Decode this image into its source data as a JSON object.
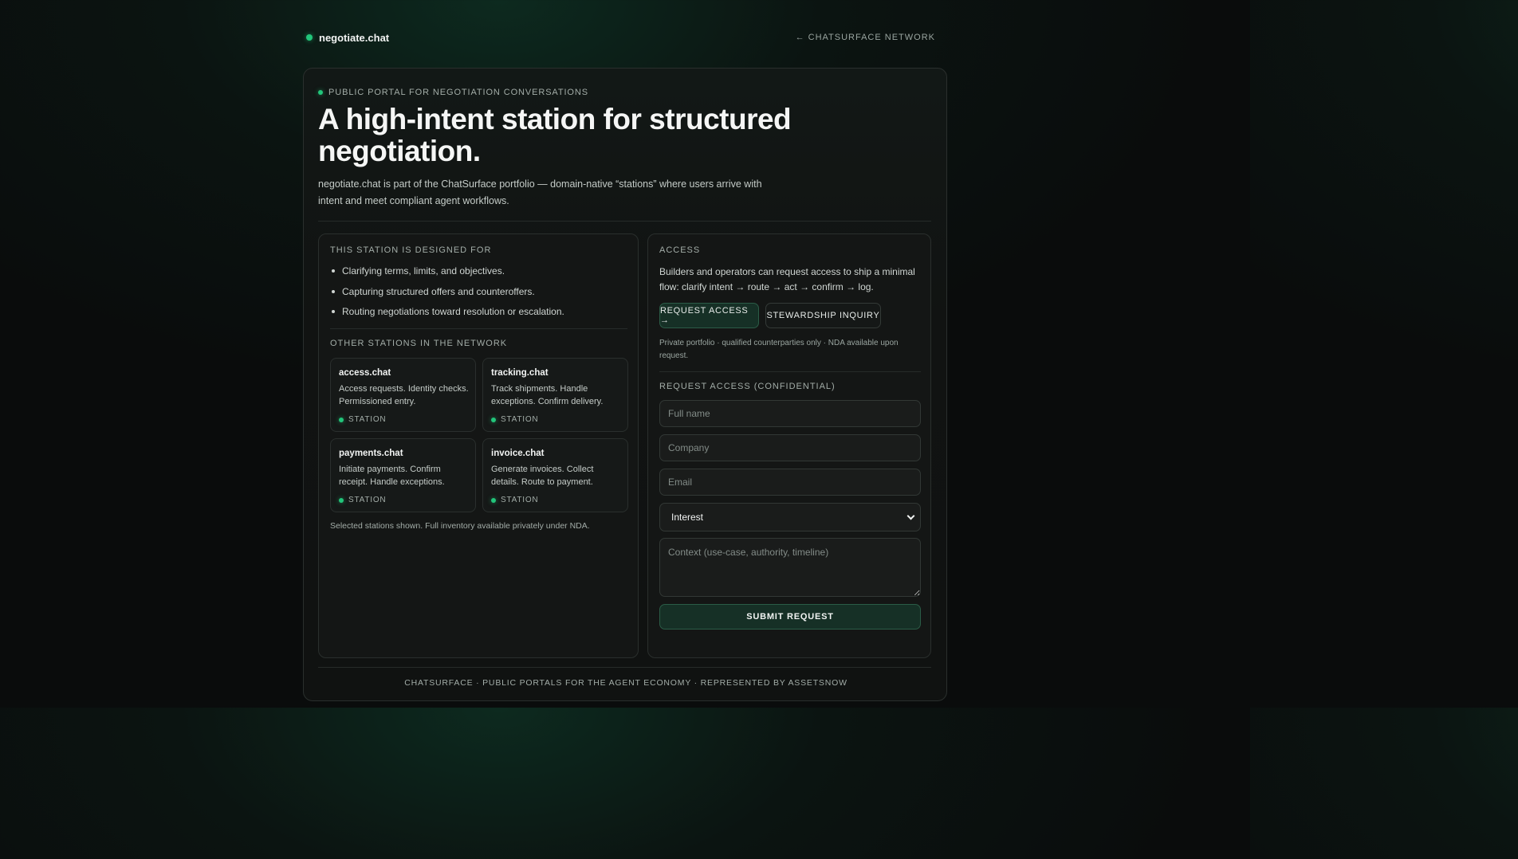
{
  "header": {
    "brand": "negotiate.chat",
    "back_link": "← CHATSURFACE NETWORK"
  },
  "hero": {
    "eyebrow": "PUBLIC PORTAL FOR NEGOTIATION CONVERSATIONS",
    "title": "A high-intent station for structured negotiation.",
    "subtitle": "negotiate.chat is part of the ChatSurface portfolio — domain-native “stations” where users arrive with intent and meet compliant agent workflows."
  },
  "designed_for": {
    "label": "THIS STATION IS DESIGNED FOR",
    "items": [
      "Clarifying terms, limits, and objectives.",
      "Capturing structured offers and counteroffers.",
      "Routing negotiations toward resolution or escalation."
    ]
  },
  "network": {
    "label": "OTHER STATIONS IN THE NETWORK",
    "stations": [
      {
        "name": "access.chat",
        "desc": "Access requests. Identity checks. Permissioned entry.",
        "tag": "STATION"
      },
      {
        "name": "tracking.chat",
        "desc": "Track shipments. Handle exceptions. Confirm delivery.",
        "tag": "STATION"
      },
      {
        "name": "payments.chat",
        "desc": "Initiate payments. Confirm receipt. Handle exceptions.",
        "tag": "STATION"
      },
      {
        "name": "invoice.chat",
        "desc": "Generate invoices. Collect details. Route to payment.",
        "tag": "STATION"
      }
    ],
    "footnote": "Selected stations shown. Full inventory available privately under NDA."
  },
  "access": {
    "label": "ACCESS",
    "text": "Builders and operators can request access to ship a minimal flow: clarify intent → route → act → confirm → log.",
    "request_button": "REQUEST ACCESS →",
    "stewardship_button": "STEWARDSHIP INQUIRY",
    "note": "Private portfolio · qualified counterparties only · NDA available upon request."
  },
  "form": {
    "label": "REQUEST ACCESS (CONFIDENTIAL)",
    "full_name_placeholder": "Full name",
    "company_placeholder": "Company",
    "email_placeholder": "Email",
    "interest_value": "Interest",
    "context_placeholder": "Context (use-case, authority, timeline)",
    "submit": "SUBMIT REQUEST"
  },
  "footer": {
    "text": "CHATSURFACE · PUBLIC PORTALS FOR THE AGENT ECONOMY · REPRESENTED BY ASSETSNOW"
  },
  "colors": {
    "accent": "#22c57a",
    "background": "#0a0c0c",
    "card": "#111312"
  }
}
